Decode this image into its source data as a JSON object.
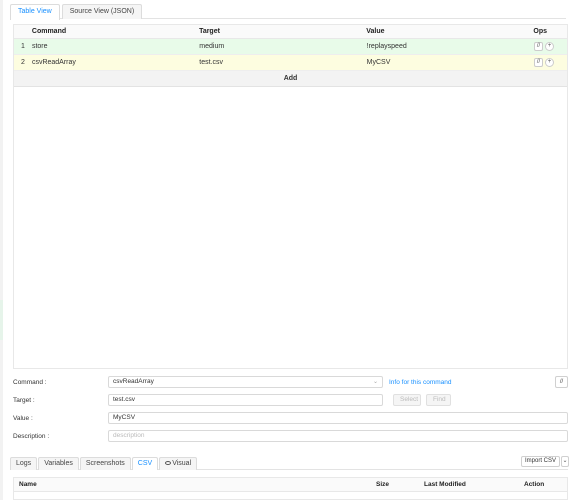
{
  "top_tabs": [
    {
      "label": "Table View",
      "active": true
    },
    {
      "label": "Source View (JSON)",
      "active": false
    }
  ],
  "table": {
    "headers": {
      "command": "Command",
      "target": "Target",
      "value": "Value",
      "ops": "Ops"
    },
    "rows": [
      {
        "num": "1",
        "command": "store",
        "target": "medium",
        "value": "!replayspeed",
        "op1": "//",
        "op2": "+",
        "bg": "#e8fbe9"
      },
      {
        "num": "2",
        "command": "csvReadArray",
        "target": "test.csv",
        "value": "MyCSV",
        "op1": "//",
        "op2": "+",
        "bg": "#fdfde0"
      }
    ],
    "add_label": "Add"
  },
  "form": {
    "command_label": "Command :",
    "command_value": "csvReadArray",
    "info_link": "Info for this command",
    "comment_btn": "//",
    "target_label": "Target :",
    "target_value": "test.csv",
    "select_btn": "Select",
    "find_btn": "Find",
    "value_label": "Value :",
    "value_value": "MyCSV",
    "description_label": "Description :",
    "description_placeholder": "description"
  },
  "bottom_tabs": [
    {
      "label": "Logs",
      "active": false
    },
    {
      "label": "Variables",
      "active": false
    },
    {
      "label": "Screenshots",
      "active": false
    },
    {
      "label": "CSV",
      "active": true
    },
    {
      "label": "Visual",
      "active": false
    }
  ],
  "import_csv": "Import CSV",
  "csv_table": {
    "headers": {
      "name": "Name",
      "size": "Size",
      "modified": "Last Modified",
      "action": "Action"
    }
  },
  "colors": {
    "accent": "#1890ff",
    "row1": "#e8fbe9",
    "row2": "#fdfde0"
  }
}
